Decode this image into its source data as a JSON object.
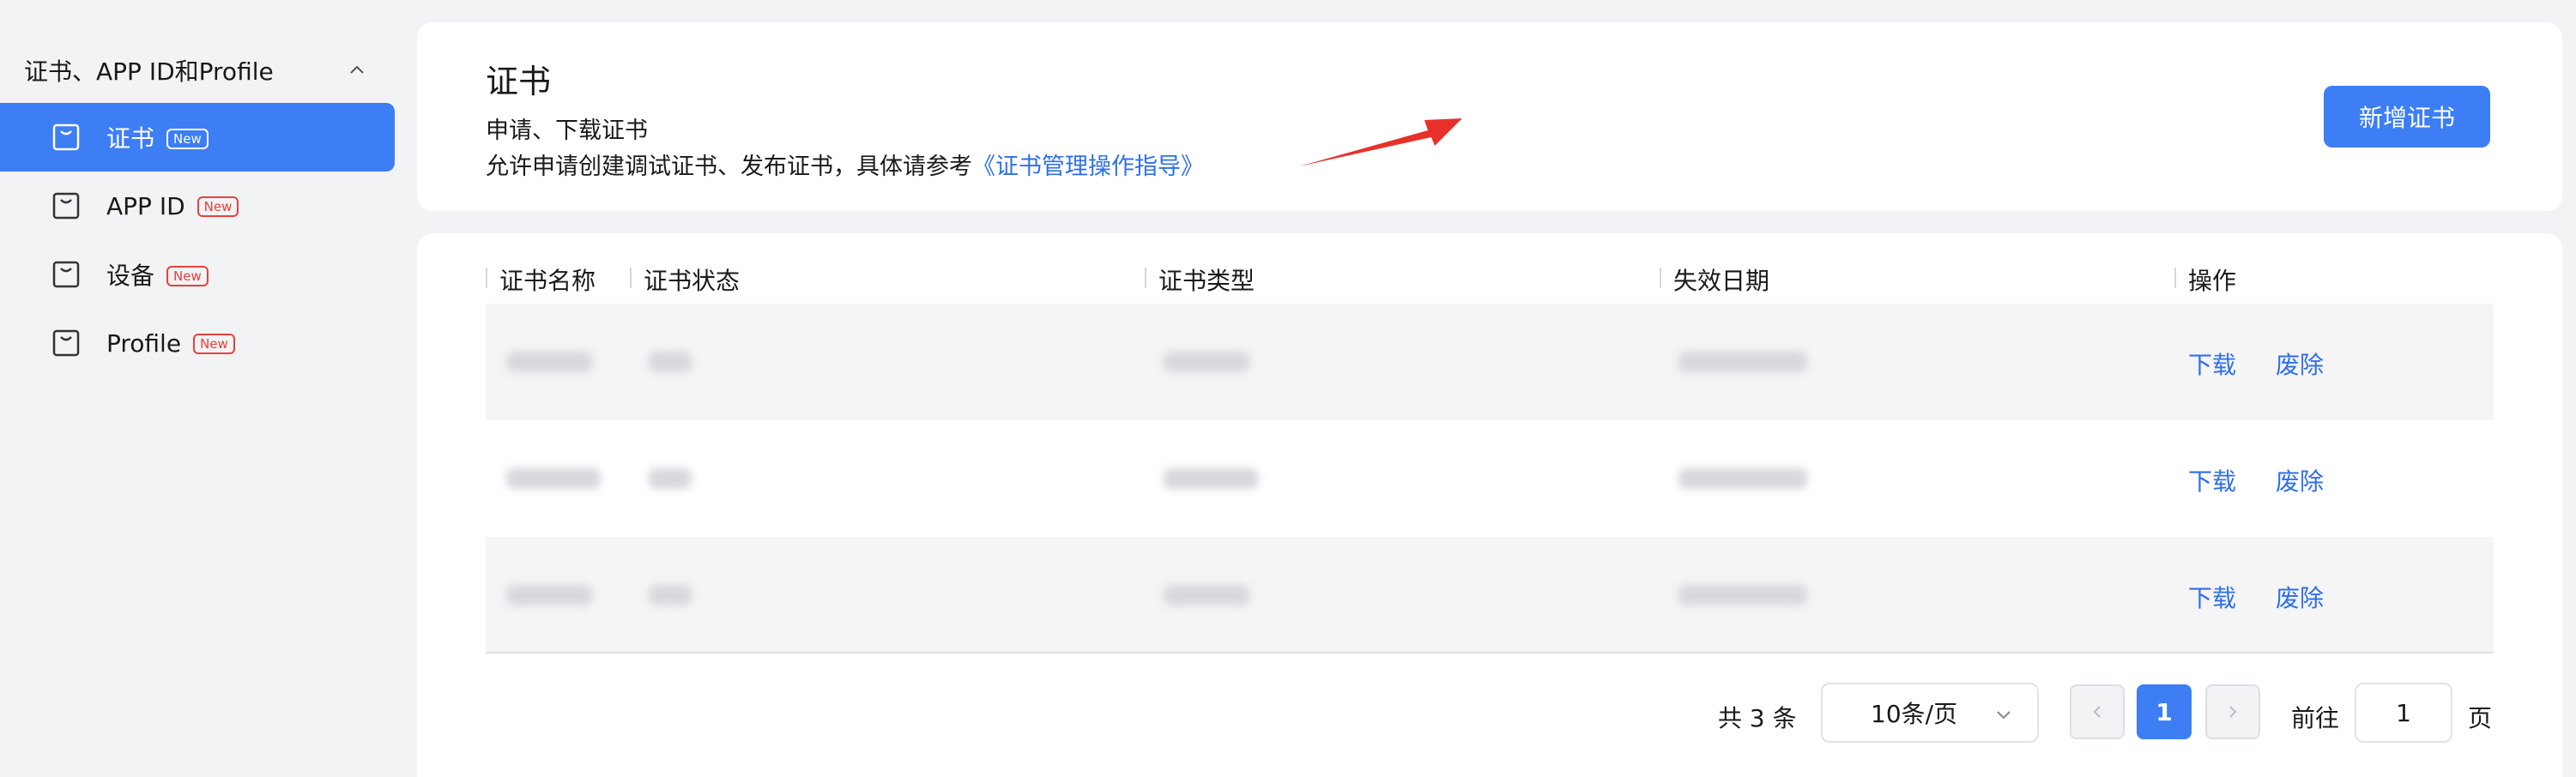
{
  "sidebar": {
    "group_label": "证书、APP ID和Profile",
    "items": [
      {
        "label": "证书",
        "badge": "New"
      },
      {
        "label": "APP ID",
        "badge": "New"
      },
      {
        "label": "设备",
        "badge": "New"
      },
      {
        "label": "Profile",
        "badge": "New"
      }
    ]
  },
  "header": {
    "title": "证书",
    "subtitle": "申请、下载证书",
    "desc_prefix": "允许申请创建调试证书、发布证书，具体请参考",
    "desc_link": "《证书管理操作指导》",
    "add_button": "新增证书"
  },
  "table": {
    "columns": [
      "证书名称",
      "证书状态",
      "证书类型",
      "失效日期",
      "操作"
    ],
    "rows": [
      {
        "actions": [
          "下载",
          "废除"
        ]
      },
      {
        "actions": [
          "下载",
          "废除"
        ]
      },
      {
        "actions": [
          "下载",
          "废除"
        ]
      }
    ]
  },
  "pagination": {
    "total_text": "共 3 条",
    "page_size": "10条/页",
    "current_page": "1",
    "goto_label": "前往",
    "goto_value": "1",
    "page_unit": "页"
  },
  "colors": {
    "accent": "#3d7ef5",
    "link": "#2f6fe8",
    "badge": "#e8403a",
    "arrow": "#e8302a"
  }
}
